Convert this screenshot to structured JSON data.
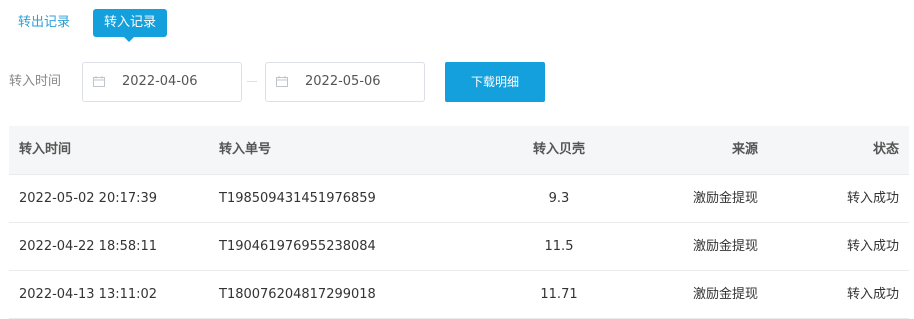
{
  "tabs": {
    "transfer_out": "转出记录",
    "transfer_in": "转入记录"
  },
  "filter": {
    "label": "转入时间",
    "start_date": "2022-04-06",
    "end_date": "2022-05-06",
    "download_label": "下载明细"
  },
  "table": {
    "headers": {
      "time": "转入时间",
      "number": "转入单号",
      "amount": "转入贝壳",
      "source": "来源",
      "status": "状态"
    },
    "rows": [
      {
        "time": "2022-05-02 20:17:39",
        "number": "T198509431451976859",
        "amount": "9.3",
        "source": "激励金提现",
        "status": "转入成功"
      },
      {
        "time": "2022-04-22 18:58:11",
        "number": "T190461976955238084",
        "amount": "11.5",
        "source": "激励金提现",
        "status": "转入成功"
      },
      {
        "time": "2022-04-13 13:11:02",
        "number": "T180076204817299018",
        "amount": "11.71",
        "source": "激励金提现",
        "status": "转入成功"
      }
    ]
  },
  "icons": {
    "calendar": "calendar-icon"
  },
  "colors": {
    "accent": "#13a0dd",
    "tab_text": "#2d9fd5",
    "header_bg": "#f5f6f7"
  }
}
